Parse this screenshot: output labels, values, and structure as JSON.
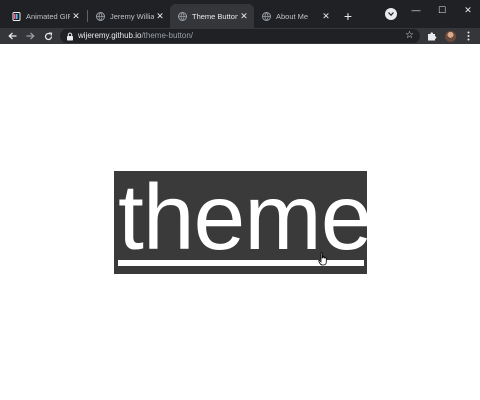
{
  "tabs": [
    {
      "label": "Animated GIF",
      "icon": "file-doc-icon",
      "active": false
    },
    {
      "label": "Jeremy Williams",
      "icon": "globe-icon",
      "active": false
    },
    {
      "label": "Theme Button",
      "icon": "globe-icon",
      "active": true
    },
    {
      "label": "About Me",
      "icon": "globe-icon",
      "active": false
    }
  ],
  "newtab_symbol": "+",
  "window_controls": {
    "minimize": "—",
    "maximize": "☐",
    "close": "✕"
  },
  "address": {
    "host": "wijeremy.github.io",
    "path": "/theme-button/"
  },
  "page": {
    "button_text": "theme",
    "button_bg": "#3a3a3a",
    "button_fg": "#ffffff"
  },
  "colors": {
    "tabstrip": "#202124",
    "toolbar": "#35363a",
    "page_bg": "#ffffff"
  }
}
